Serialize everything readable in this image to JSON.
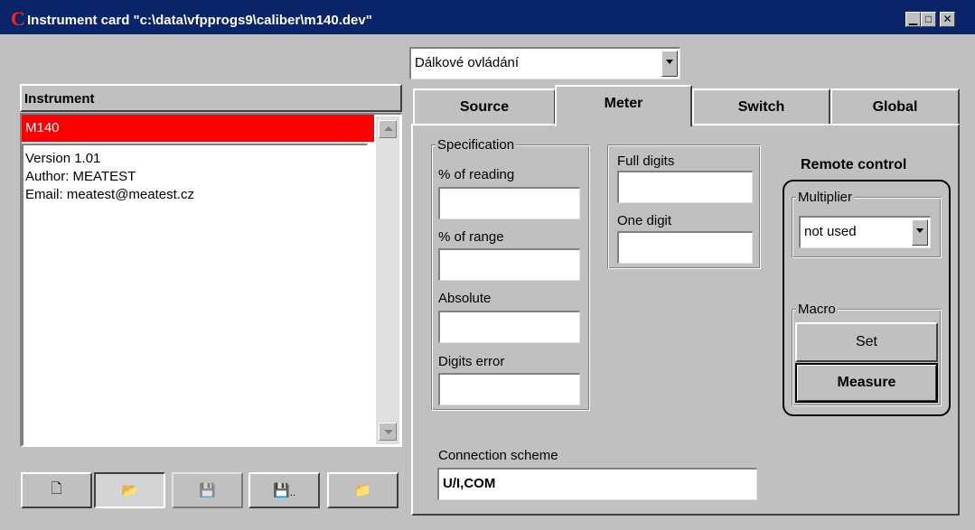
{
  "window": {
    "title": "Instrument card \"c:\\data\\vfpprogs9\\caliber\\m140.dev\"",
    "app_icon": "C",
    "minimize_glyph": "▁",
    "maximize_glyph": "□",
    "close_glyph": "✕"
  },
  "mode_combo": {
    "value": "Dálkové ovládání"
  },
  "instrument": {
    "header": "Instrument",
    "selected": "M140",
    "info": [
      "Version 1.01",
      "Author: MEATEST",
      "Email: meatest@meatest.cz"
    ]
  },
  "toolbar": {
    "buttons": [
      {
        "name": "new-file-icon",
        "glyph": "🗋",
        "enabled": true
      },
      {
        "name": "open-folder-icon",
        "glyph": "📂",
        "enabled": true
      },
      {
        "name": "save-icon",
        "glyph": "💾",
        "enabled": false
      },
      {
        "name": "save-as-icon",
        "glyph": "💾",
        "suffix": "..",
        "enabled": true
      },
      {
        "name": "export-folder-icon",
        "glyph": "📁",
        "enabled": true
      }
    ]
  },
  "tabs": [
    {
      "label": "Source",
      "active": false
    },
    {
      "label": "Meter",
      "active": true
    },
    {
      "label": "Switch",
      "active": false
    },
    {
      "label": "Global",
      "active": false
    }
  ],
  "meter": {
    "specification": {
      "legend": "Specification",
      "pct_reading_label": "% of reading",
      "pct_reading_value": "",
      "pct_range_label": "% of range",
      "pct_range_value": "",
      "absolute_label": "Absolute",
      "absolute_value": "",
      "digits_error_label": "Digits error",
      "digits_error_value": ""
    },
    "digits": {
      "full_digits_label": "Full digits",
      "full_digits_value": "",
      "one_digit_label": "One digit",
      "one_digit_value": ""
    },
    "remote_control": {
      "title": "Remote control",
      "multiplier_legend": "Multiplier",
      "multiplier_value": "not used",
      "macro_legend": "Macro",
      "set_label": "Set",
      "measure_label": "Measure"
    },
    "connection": {
      "label": "Connection scheme",
      "value": "U/I,COM"
    }
  }
}
